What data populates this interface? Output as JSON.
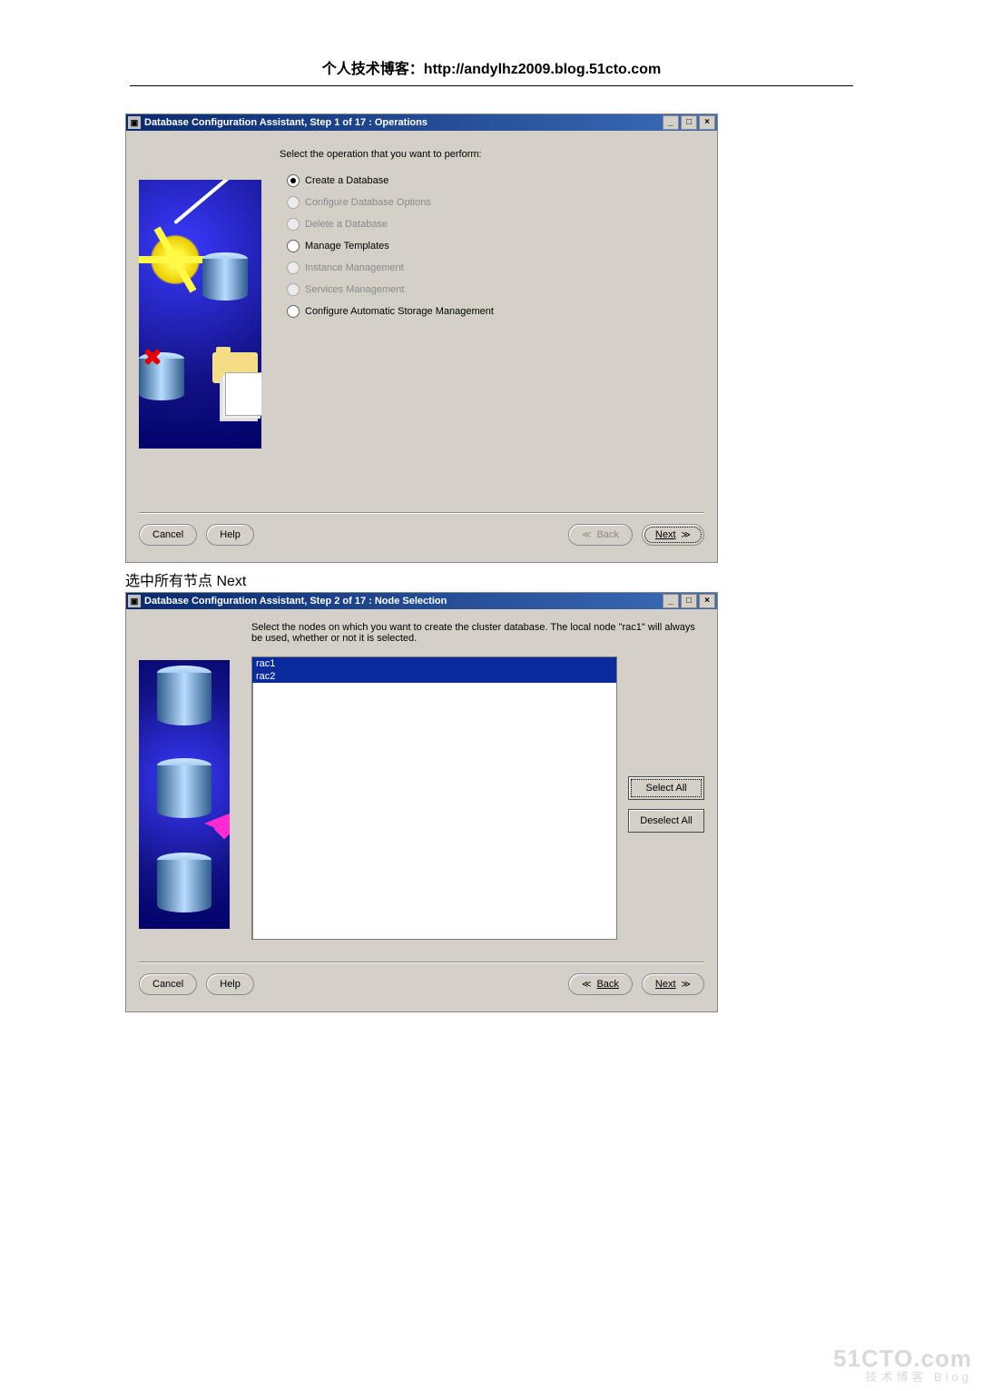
{
  "header": {
    "text": "个人技术博客：http://andylhz2009.blog.51cto.com"
  },
  "dialog1": {
    "title": "Database Configuration Assistant, Step 1 of 17 : Operations",
    "instruction": "Select the operation that you want to perform:",
    "options": {
      "create": {
        "label": "Create a Database",
        "disabled": false,
        "selected": true
      },
      "config": {
        "label": "Configure Database Options",
        "disabled": true,
        "selected": false
      },
      "delete": {
        "label": "Delete a Database",
        "disabled": true,
        "selected": false
      },
      "template": {
        "label": "Manage Templates",
        "disabled": false,
        "selected": false
      },
      "instmgmt": {
        "label": "Instance Management",
        "disabled": true,
        "selected": false
      },
      "svcmgmt": {
        "label": "Services Management",
        "disabled": true,
        "selected": false
      },
      "asm": {
        "label": "Configure Automatic Storage Management",
        "disabled": false,
        "selected": false
      }
    },
    "buttons": {
      "cancel": "Cancel",
      "help": "Help",
      "back": "Back",
      "next": "Next"
    }
  },
  "caption1": "选中所有节点  Next",
  "dialog2": {
    "title": "Database Configuration Assistant, Step 2 of 17 : Node Selection",
    "instruction": "Select the nodes on which you want to create the cluster database. The local node \"rac1\" will always be used, whether or not it is selected.",
    "nodes": [
      "rac1",
      "rac2"
    ],
    "sidebuttons": {
      "select_all": "Select All",
      "deselect_all": "Deselect All"
    },
    "buttons": {
      "cancel": "Cancel",
      "help": "Help",
      "back": "Back",
      "next": "Next"
    }
  },
  "watermark": {
    "big": "51CTO.com",
    "small": "技术博客  Blog"
  }
}
